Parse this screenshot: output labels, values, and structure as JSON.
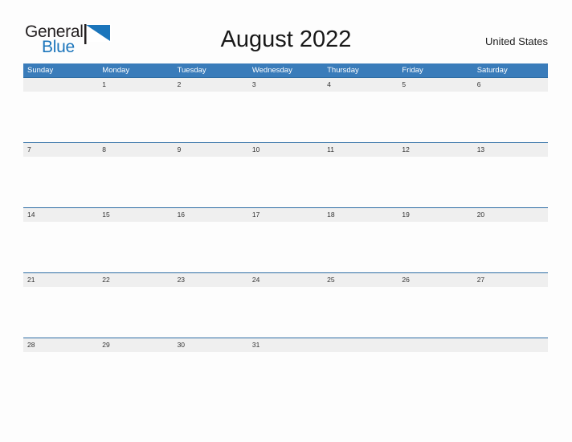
{
  "brand": {
    "name_top": "General",
    "name_bottom": "Blue",
    "top_color": "#231f20",
    "bottom_color": "#1b75bb",
    "flag_color": "#1b75bb",
    "flag_icon": "blue-flag-triangle-icon"
  },
  "header": {
    "title": "August 2022",
    "region": "United States"
  },
  "colors": {
    "header_band": "#3a7cba",
    "row_band": "#efefef",
    "row_rule": "#2e6da4",
    "page_background": "#fdfdfd",
    "date_text": "#333333",
    "weekday_text": "#ffffff"
  },
  "calendar": {
    "month": "August",
    "year": "2022",
    "weekdays": [
      "Sunday",
      "Monday",
      "Tuesday",
      "Wednesday",
      "Thursday",
      "Friday",
      "Saturday"
    ],
    "weeks": [
      [
        "",
        "1",
        "2",
        "3",
        "4",
        "5",
        "6"
      ],
      [
        "7",
        "8",
        "9",
        "10",
        "11",
        "12",
        "13"
      ],
      [
        "14",
        "15",
        "16",
        "17",
        "18",
        "19",
        "20"
      ],
      [
        "21",
        "22",
        "23",
        "24",
        "25",
        "26",
        "27"
      ],
      [
        "28",
        "29",
        "30",
        "31",
        "",
        "",
        ""
      ]
    ]
  }
}
